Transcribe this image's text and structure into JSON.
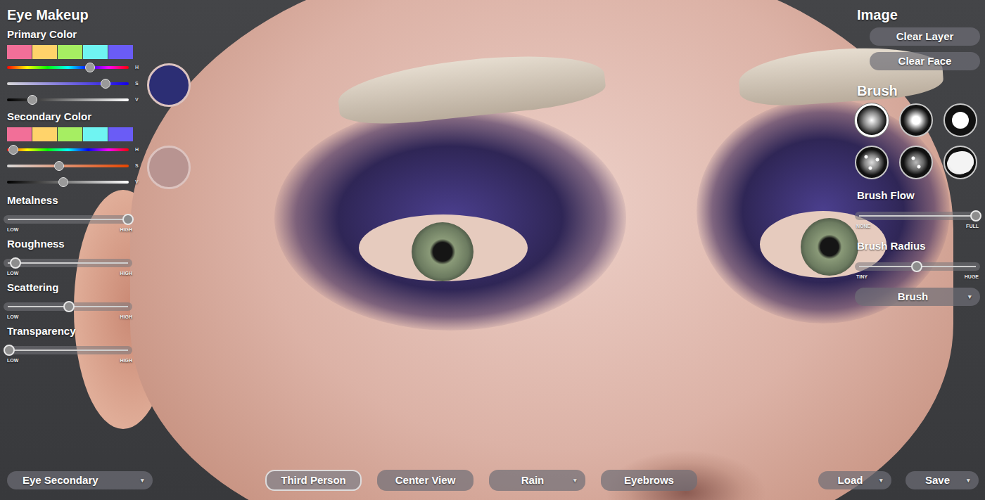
{
  "editor": {
    "title": "Eye Makeup"
  },
  "primary_color": {
    "label": "Primary Color",
    "swatches": [
      {
        "color": "#f26f98"
      },
      {
        "color": "#ffd36a"
      },
      {
        "color": "#a6ee62"
      },
      {
        "color": "#6ff4f2"
      },
      {
        "color": "#6a5cf6"
      }
    ],
    "sliders": [
      {
        "axis": "H",
        "kind": "hue",
        "level": 0.68
      },
      {
        "axis": "S",
        "kind": "saturation",
        "level": 0.81
      },
      {
        "axis": "V",
        "kind": "value",
        "level": 0.21
      }
    ],
    "preview_color": "#2c2e74"
  },
  "secondary_color": {
    "label": "Secondary Color",
    "swatches": [
      {
        "color": "#f26f98"
      },
      {
        "color": "#ffd36a"
      },
      {
        "color": "#a6ee62"
      },
      {
        "color": "#6ff4f2"
      },
      {
        "color": "#6a5cf6"
      }
    ],
    "sliders": [
      {
        "axis": "H",
        "kind": "hue",
        "level": 0.05
      },
      {
        "axis": "S",
        "kind": "saturation",
        "level": 0.43
      },
      {
        "axis": "V",
        "kind": "value",
        "level": 0.46
      }
    ],
    "preview_color": "#b89491"
  },
  "material_sliders": [
    {
      "label": "Metalness",
      "level": 0.96,
      "low": "LOW",
      "high": "HIGH"
    },
    {
      "label": "Roughness",
      "level": 0.09,
      "low": "LOW",
      "high": "HIGH"
    },
    {
      "label": "Scattering",
      "level": 0.5,
      "low": "LOW",
      "high": "HIGH"
    },
    {
      "label": "Transparency",
      "level": 0.04,
      "low": "LOW",
      "high": "HIGH"
    }
  ],
  "image_panel": {
    "title": "Image",
    "buttons": [
      "Clear Layer",
      "Clear Face"
    ]
  },
  "brush_panel": {
    "title": "Brush",
    "brushes": [
      {
        "kind": "soft",
        "selected": true
      },
      {
        "kind": "medium",
        "selected": false
      },
      {
        "kind": "hard",
        "selected": false
      },
      {
        "kind": "speckle",
        "selected": false
      },
      {
        "kind": "grain",
        "selected": false
      },
      {
        "kind": "splat",
        "selected": false
      }
    ],
    "sliders": [
      {
        "label": "Brush Flow",
        "level": 0.96,
        "low": "NONE",
        "high": "FULL"
      },
      {
        "label": "Brush Radius",
        "level": 0.49,
        "low": "TINY",
        "high": "HUGE"
      }
    ],
    "dropdown": {
      "label": "Brush",
      "caret": "▾"
    }
  },
  "bottom_bar": {
    "layer_dropdown": {
      "label": "Eye Secondary",
      "caret": "▾"
    },
    "view_buttons": [
      {
        "label": "Third Person",
        "selected": true
      },
      {
        "label": "Center View",
        "selected": false
      },
      {
        "label": "Rain",
        "selected": false,
        "caret": "▾"
      },
      {
        "label": "Eyebrows",
        "selected": false
      }
    ],
    "file_buttons": [
      {
        "label": "Load",
        "caret": "▾"
      },
      {
        "label": "Save",
        "caret": "▾"
      }
    ]
  }
}
